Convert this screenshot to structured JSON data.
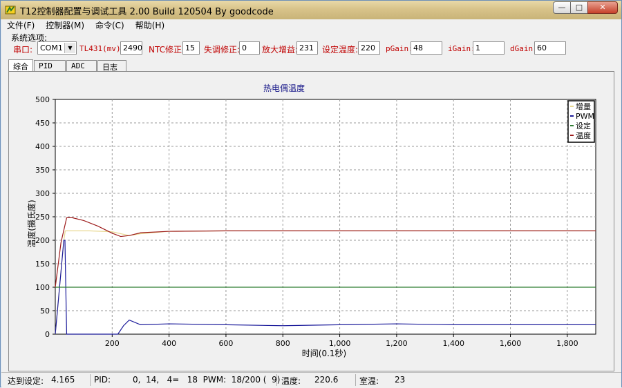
{
  "window": {
    "title": "T12控制器配置与调试工具 2.00 Build 120504 By goodcode",
    "minimize": "—",
    "maximize": "□",
    "close": "✕"
  },
  "menu": [
    "文件(F)",
    "控制器(M)",
    "命令(C)",
    "帮助(H)"
  ],
  "system_options": {
    "group_label": "系统选项:",
    "port_label": "串口:",
    "port_value": "COM1",
    "tl431_label": "TL431(mv)",
    "tl431_value": "2490",
    "ntc_label": "NTC修正:",
    "ntc_value": "15",
    "offset_label": "失调修正:",
    "offset_value": "0",
    "gain_label": "放大增益:",
    "gain_value": "231",
    "settemp_label": "设定温度:",
    "settemp_value": "220",
    "pgain_label": "pGain:",
    "pgain_value": "48",
    "igain_label": "iGain:",
    "igain_value": "1",
    "dgain_label": "dGain:",
    "dgain_value": "60"
  },
  "tabs": [
    "综合",
    "PID",
    "ADC",
    "日志"
  ],
  "status": {
    "reach_label": "达到设定:",
    "reach_value": "4.165",
    "pid_label": "PID:",
    "pid_value": "0,  14,   4=   18  PWM:  18/200 (  9)",
    "temp_label": "温度:",
    "temp_value": "220.6",
    "room_label": "室温:",
    "room_value": "23"
  },
  "chart_data": {
    "type": "line",
    "title": "热电偶温度",
    "xlabel": "时间(0.1秒)",
    "ylabel": "温度(摄氏度)",
    "xlim": [
      0,
      1900
    ],
    "ylim": [
      0,
      500
    ],
    "xticks": [
      200,
      400,
      600,
      800,
      1000,
      1200,
      1400,
      1600,
      1800
    ],
    "xtick_labels": [
      "200",
      "400",
      "600",
      "800",
      "1,000",
      "1,200",
      "1,400",
      "1,600",
      "1,800"
    ],
    "yticks": [
      0,
      50,
      100,
      150,
      200,
      250,
      300,
      350,
      400,
      450,
      500
    ],
    "grid": true,
    "legend_position": "top-right",
    "series": [
      {
        "name": "增量",
        "color": "#e8d890",
        "x": [
          0,
          30,
          35,
          60,
          120,
          200,
          260,
          300,
          400,
          600,
          800,
          1000,
          1200,
          1400,
          1600,
          1800,
          1900
        ],
        "y": [
          0,
          200,
          220,
          220,
          220,
          218,
          210,
          214,
          219,
          220,
          220,
          220,
          220,
          220,
          220,
          220,
          220
        ]
      },
      {
        "name": "PWM",
        "color": "#1a1a9a",
        "x": [
          0,
          30,
          34,
          36,
          40,
          220,
          240,
          260,
          300,
          400,
          600,
          800,
          1000,
          1200,
          1400,
          1600,
          1800,
          1900
        ],
        "y": [
          0,
          200,
          200,
          130,
          0,
          0,
          18,
          30,
          20,
          22,
          20,
          18,
          20,
          22,
          20,
          20,
          20,
          20
        ]
      },
      {
        "name": "设定",
        "color": "#2e7d32",
        "x": [
          0,
          1900
        ],
        "y": [
          100,
          100
        ]
      },
      {
        "name": "温度",
        "color": "#9c1a1a",
        "x": [
          0,
          20,
          40,
          60,
          100,
          150,
          200,
          230,
          260,
          300,
          400,
          600,
          800,
          1000,
          1200,
          1400,
          1600,
          1800,
          1900
        ],
        "y": [
          100,
          195,
          248,
          248,
          242,
          230,
          215,
          208,
          210,
          216,
          219,
          220,
          220,
          220,
          220,
          220,
          220,
          220,
          220
        ]
      }
    ]
  }
}
